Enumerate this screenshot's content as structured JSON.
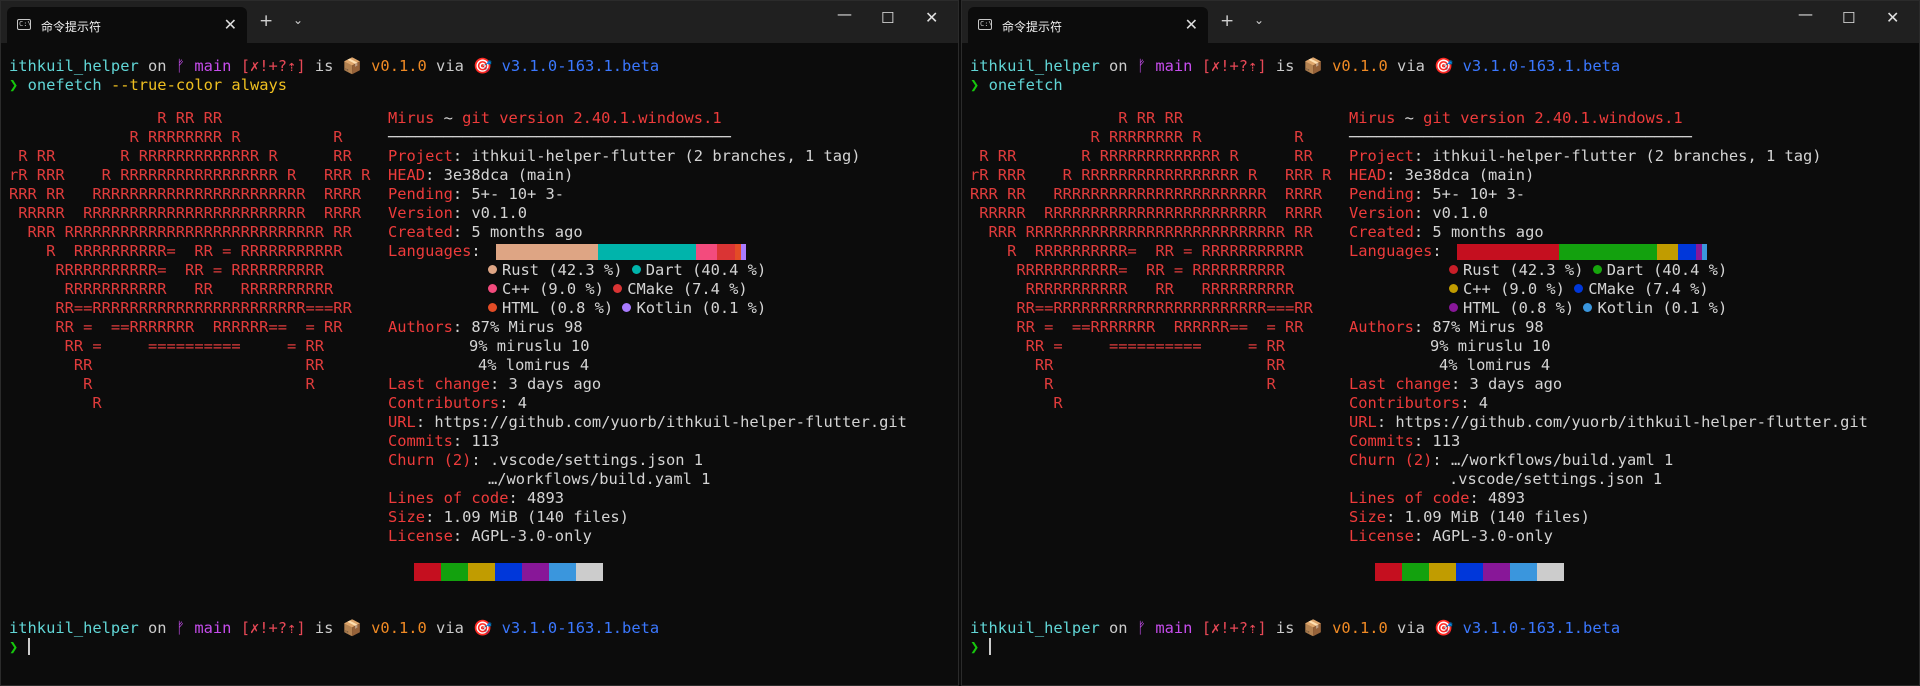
{
  "windows": [
    {
      "tab_title": "命令提示符",
      "prompt": {
        "dir": "ithkuil_helper",
        "on": "on",
        "branch_icon": "ᚠ",
        "branch": "main",
        "status": "[✗!+?⇡]",
        "is": "is",
        "pkg_icon": "📦",
        "version": "v0.1.0",
        "via": "via",
        "tool_icon": "🎯",
        "tool_version": "v3.1.0-163.1.beta"
      },
      "command": {
        "arrow": "❯",
        "name": "onefetch",
        "args": " --true-color always"
      },
      "header": {
        "user": "Mirus",
        "sep": " ~ ",
        "git": "git version 2.40.1.windows.1"
      },
      "underline": "─────────────────────────────────────",
      "info": {
        "project_k": "Project",
        "project_v": ": ithkuil-helper-flutter (2 branches, 1 tag)",
        "head_k": "HEAD",
        "head_v": ": 3e38dca (main)",
        "pending_k": "Pending",
        "pending_v": ": 5+- 10+ 3-",
        "version_k": "Version",
        "version_v": ": v0.1.0",
        "created_k": "Created",
        "created_v": ": 5 months ago",
        "languages_k": "Languages",
        "languages_v": ": ",
        "lang1": "Rust (42.3 %)",
        "lang2": "Dart (40.4 %)",
        "lang3": "C++ (9.0 %)",
        "lang4": "CMake (7.4 %)",
        "lang5": "HTML (0.8 %)",
        "lang6": "Kotlin (0.1 %)",
        "authors_k": "Authors",
        "authors_v": ": 87% Mirus 98",
        "author2": "9% miruslu 10",
        "author3": "4% lomirus 4",
        "lastchange_k": "Last change",
        "lastchange_v": ": 3 days ago",
        "contrib_k": "Contributors",
        "contrib_v": ": 4",
        "url_k": "URL",
        "url_v": ": https://github.com/yuorb/ithkuil-helper-flutter.git",
        "commits_k": "Commits",
        "commits_v": ": 113",
        "churn_k": "Churn (2)",
        "churn_v": ": .vscode/settings.json 1",
        "churn2": "…/workflows/build.yaml 1",
        "loc_k": "Lines of code",
        "loc_v": ": 4893",
        "size_k": "Size",
        "size_v": ": 1.09 MiB (140 files)",
        "license_k": "License",
        "license_v": ": AGPL-3.0-only"
      },
      "lang_dot_colors": [
        "#dea584",
        "#00b4ab",
        "#f34b7d",
        "#da3434",
        "#e34c26",
        "#a97bff"
      ]
    },
    {
      "tab_title": "命令提示符",
      "prompt": {
        "dir": "ithkuil_helper",
        "on": "on",
        "branch_icon": "ᚠ",
        "branch": "main",
        "status": "[✗!+?⇡]",
        "is": "is",
        "pkg_icon": "📦",
        "version": "v0.1.0",
        "via": "via",
        "tool_icon": "🎯",
        "tool_version": "v3.1.0-163.1.beta"
      },
      "command": {
        "arrow": "❯",
        "name": "onefetch",
        "args": ""
      },
      "header": {
        "user": "Mirus",
        "sep": " ~ ",
        "git": "git version 2.40.1.windows.1"
      },
      "underline": "─────────────────────────────────────",
      "info": {
        "project_k": "Project",
        "project_v": ": ithkuil-helper-flutter (2 branches, 1 tag)",
        "head_k": "HEAD",
        "head_v": ": 3e38dca (main)",
        "pending_k": "Pending",
        "pending_v": ": 5+- 10+ 3-",
        "version_k": "Version",
        "version_v": ": v0.1.0",
        "created_k": "Created",
        "created_v": ": 5 months ago",
        "languages_k": "Languages",
        "languages_v": ": ",
        "lang1": "Rust (42.3 %)",
        "lang2": "Dart (40.4 %)",
        "lang3": "C++ (9.0 %)",
        "lang4": "CMake (7.4 %)",
        "lang5": "HTML (0.8 %)",
        "lang6": "Kotlin (0.1 %)",
        "authors_k": "Authors",
        "authors_v": ": 87% Mirus 98",
        "author2": "9% miruslu 10",
        "author3": "4% lomirus 4",
        "lastchange_k": "Last change",
        "lastchange_v": ": 3 days ago",
        "contrib_k": "Contributors",
        "contrib_v": ": 4",
        "url_k": "URL",
        "url_v": ": https://github.com/yuorb/ithkuil-helper-flutter.git",
        "commits_k": "Commits",
        "commits_v": ": 113",
        "churn_k": "Churn (2)",
        "churn_v": ": …/workflows/build.yaml 1",
        "churn2": ".vscode/settings.json 1",
        "loc_k": "Lines of code",
        "loc_v": ": 4893",
        "size_k": "Size",
        "size_v": ": 1.09 MiB (140 files)",
        "license_k": "License",
        "license_v": ": AGPL-3.0-only"
      },
      "lang_dot_colors": [
        "#c81e28",
        "#16a60c",
        "#c19c00",
        "#0037da",
        "#881798",
        "#3a96dd"
      ]
    }
  ],
  "logo_lines": [
    "                R RR RR",
    "             R RRRRRRRR R          R",
    " R RR       R RRRRRRRRRRRRR R      RR",
    "rR RRR    R RRRRRRRRRRRRRRRRR R   RRR R",
    "RRR RR   RRRRRRRRRRRRRRRRRRRRRRR  RRRR",
    " RRRRR  RRRRRRRRRRRRRRRRRRRRRRRR  RRRR",
    "  RRR RRRRRRRRRRRRRRRRRRRRRRRRRRRR RR",
    "    R  RRRRRRRRRR=  RR = RRRRRRRRRRR",
    "     RRRRRRRRRRR=  RR = RRRRRRRRRR",
    "      RRRRRRRRRRR   RR   RRRRRRRRRR",
    "     RR==RRRRRRRRRRRRRRRRRRRRRRR===RR",
    "     RR =  ==RRRRRRR  RRRRRR==  = RR",
    "      RR =     ==========     = RR",
    "       RR                       RR",
    "        R                       R",
    "         R"
  ],
  "palette": [
    "#c50f1f",
    "#13a10e",
    "#c19c00",
    "#0037da",
    "#881798",
    "#3a96dd",
    "#cccccc"
  ],
  "bar_colors_1": [
    "#dea584",
    "#00b4ab",
    "#f34b7d",
    "#da3434",
    "#e34c26",
    "#a97bff"
  ],
  "bar_colors_2": [
    "#c50f1f",
    "#13a10e",
    "#c19c00",
    "#0037da",
    "#881798",
    "#3a96dd"
  ],
  "lang_shares": [
    42.3,
    40.4,
    9.0,
    7.4,
    0.8,
    0.1
  ]
}
